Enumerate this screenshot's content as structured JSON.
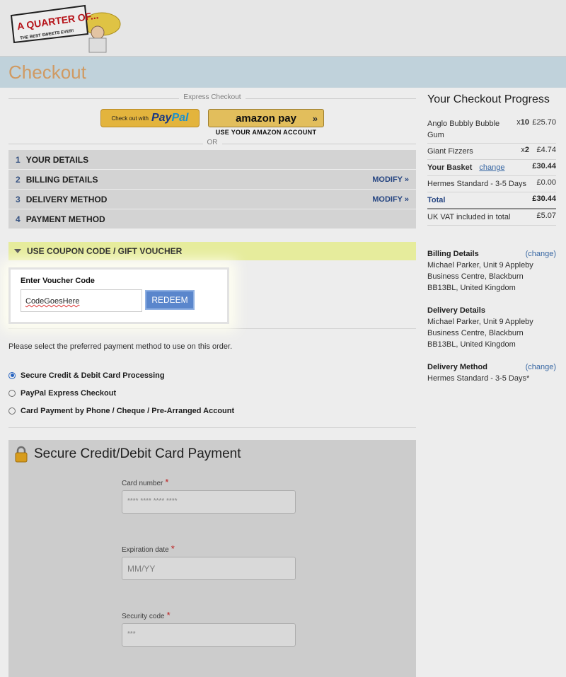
{
  "header": {
    "logo_text": "A QUARTER OF...",
    "logo_tagline": "THE BEST SWEETS EVER!"
  },
  "page_title": "Checkout",
  "express": {
    "label": "Express Checkout",
    "paypal_small": "Check out with",
    "paypal_pay": "Pay",
    "paypal_pal": "Pal",
    "amazon_label": "amazon pay",
    "amazon_sub": "USE YOUR AMAZON ACCOUNT",
    "or": "OR"
  },
  "steps": [
    {
      "num": "1",
      "label": "YOUR DETAILS",
      "action": ""
    },
    {
      "num": "2",
      "label": "BILLING DETAILS",
      "action": "MODIFY »"
    },
    {
      "num": "3",
      "label": "DELIVERY METHOD",
      "action": "MODIFY »"
    },
    {
      "num": "4",
      "label": "PAYMENT METHOD",
      "action": ""
    }
  ],
  "coupon": {
    "header": "USE COUPON CODE / GIFT VOUCHER",
    "field_label": "Enter Voucher Code",
    "value": "CodeGoesHere",
    "button": "REDEEM"
  },
  "payment": {
    "instructions": "Please select the preferred payment method to use on this order.",
    "options": [
      {
        "label": "Secure Credit & Debit Card Processing",
        "selected": true
      },
      {
        "label": "PayPal Express Checkout",
        "selected": false
      },
      {
        "label": "Card Payment by Phone / Cheque / Pre-Arranged Account",
        "selected": false
      }
    ]
  },
  "card_form": {
    "title": "Secure Credit/Debit Card Payment",
    "fields": [
      {
        "label": "Card number",
        "placeholder": "**** **** **** ****"
      },
      {
        "label": "Expiration date",
        "placeholder": "MM/YY"
      },
      {
        "label": "Security code",
        "placeholder": "***"
      }
    ],
    "required_mark": "*"
  },
  "progress": {
    "title": "Your Checkout Progress",
    "items": [
      {
        "name": "Anglo Bubbly Bubble Gum",
        "qty_prefix": "x",
        "qty": "10",
        "price": "£25.70"
      },
      {
        "name": "Giant Fizzers",
        "qty_prefix": "x",
        "qty": "2",
        "price": "£4.74"
      }
    ],
    "basket_label": "Your Basket",
    "basket_change": "change",
    "basket_price": "£30.44",
    "shipping_label": "Hermes Standard - 3-5 Days",
    "shipping_price": "£0.00",
    "total_label": "Total",
    "total_price": "£30.44",
    "vat_label": "UK VAT included in total",
    "vat_price": "£5.07",
    "billing": {
      "title": "Billing Details",
      "change": "(change)",
      "address": "Michael Parker, Unit 9 Appleby Business Centre, Blackburn BB13BL, United Kingdom"
    },
    "delivery": {
      "title": "Delivery Details",
      "address": "Michael Parker, Unit 9 Appleby Business Centre, Blackburn BB13BL, United Kingdom"
    },
    "method": {
      "title": "Delivery Method",
      "change": "(change)",
      "value": "Hermes Standard - 3-5 Days*"
    }
  },
  "colors": {
    "accent": "#5a86cc",
    "coupon_bar": "#e6ec9c",
    "title": "#e0a66a"
  }
}
